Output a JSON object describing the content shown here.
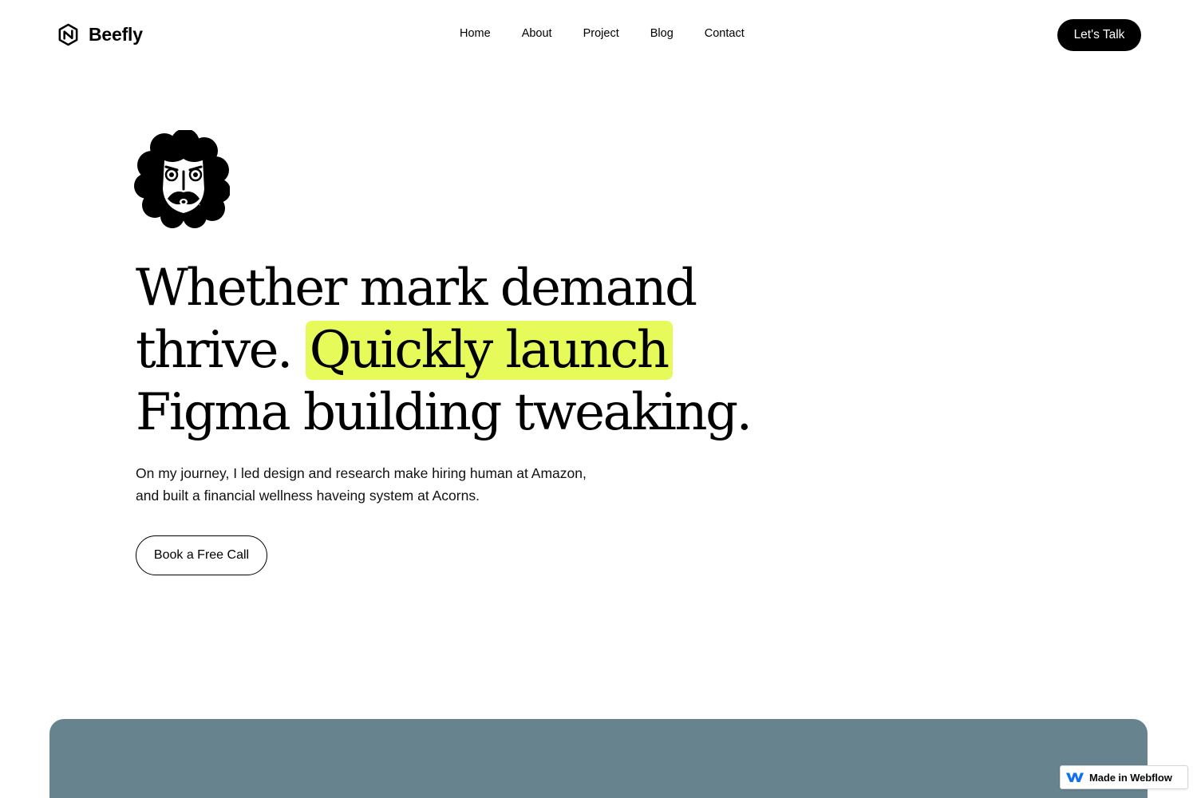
{
  "brand": {
    "name": "Beefly",
    "logo_icon": "hexagon-logo-icon"
  },
  "nav": {
    "items": [
      {
        "label": "Home"
      },
      {
        "label": "About"
      },
      {
        "label": "Project"
      },
      {
        "label": "Blog"
      },
      {
        "label": "Contact"
      }
    ],
    "cta_label": "Let's Talk"
  },
  "hero": {
    "avatar_icon": "bearded-face-illustration",
    "headline": {
      "part1": "Whether mark demand thrive. ",
      "highlight": "Quickly launch",
      "part2": " Figma building tweaking."
    },
    "intro_line1": "On my journey, I led design and research make hiring human at Amazon,",
    "intro_line2": "and built a financial wellness haveing system at Acorns.",
    "button_label": "Book a Free Call"
  },
  "colors": {
    "highlight": "#e6fb5a",
    "panel": "#66838e",
    "primary": "#000000",
    "badge_logo": "#146ef5"
  },
  "badge": {
    "label": "Made in Webflow",
    "icon": "webflow-logo-icon"
  }
}
